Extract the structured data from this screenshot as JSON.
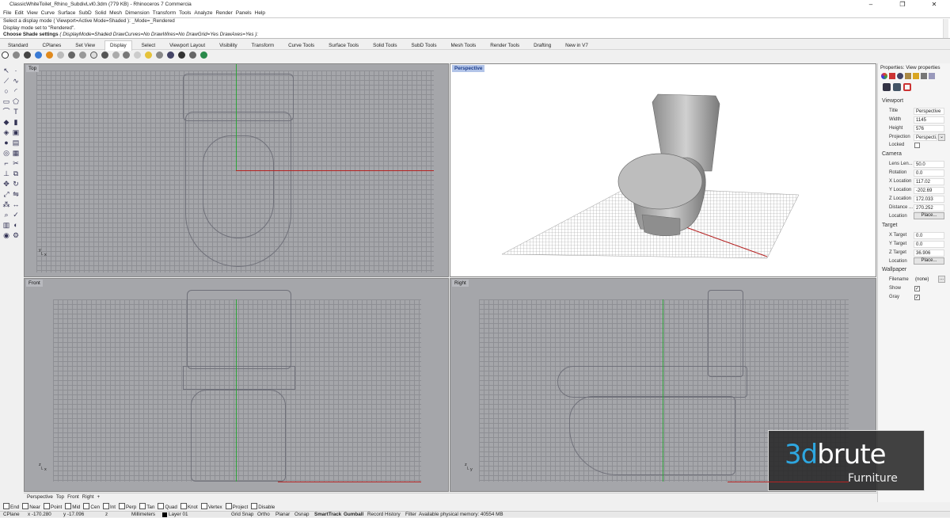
{
  "window": {
    "title": "ClassicWhiteToilet_Rhino_SubdivLvl0.3dm (779 KB) - Rhinoceros 7 Commercia",
    "min": "–",
    "max": "❐",
    "close": "✕"
  },
  "menu": [
    "File",
    "Edit",
    "View",
    "Curve",
    "Surface",
    "SubD",
    "Solid",
    "Mesh",
    "Dimension",
    "Transform",
    "Tools",
    "Analyze",
    "Render",
    "Panels",
    "Help"
  ],
  "command": {
    "line1": "Select a display mode ( Viewport=Active  Mode=Shaded ): _Mode=_Rendered",
    "line2": "Display mode set to \"Rendered\".",
    "prompt": "Choose Shade settings",
    "options": "( DisplayMode=Shaded  DrawCurves=No  DrawWires=No  DrawGrid=Yes  DrawAxes=Yes ):"
  },
  "toolbar_tabs": [
    "Standard",
    "CPlanes",
    "Set View",
    "Display",
    "Select",
    "Viewport Layout",
    "Visibility",
    "Transform",
    "Curve Tools",
    "Surface Tools",
    "Solid Tools",
    "SubD Tools",
    "Mesh Tools",
    "Render Tools",
    "Drafting",
    "New in V7"
  ],
  "active_toolbar_tab": "Display",
  "viewports": {
    "top": "Top",
    "perspective": "Perspective",
    "front": "Front",
    "right": "Right"
  },
  "viewport_tabs": [
    "Perspective",
    "Top",
    "Front",
    "Right",
    "+"
  ],
  "osnaps": [
    "End",
    "Near",
    "Point",
    "Mid",
    "Cen",
    "Int",
    "Perp",
    "Tan",
    "Quad",
    "Knot",
    "Vertex",
    "Project",
    "Disable"
  ],
  "status": {
    "cplane": "CPlane",
    "x": "x -170.280",
    "y": "y -17.096",
    "z": "z",
    "units": "Millimeters",
    "layer": "Layer 01",
    "grid_snap": "Grid Snap",
    "ortho": "Ortho",
    "planar": "Planar",
    "osnap": "Osnap",
    "smarttrack": "SmartTrack",
    "gumball": "Gumball",
    "record": "Record History",
    "filter": "Filter",
    "memory": "Available physical memory: 40554 MB"
  },
  "panel": {
    "title": "Properties: View properties",
    "viewport_section": "Viewport",
    "title_label": "Title",
    "title_value": "Perspective",
    "width_label": "Width",
    "width_value": "1145",
    "height_label": "Height",
    "height_value": "576",
    "projection_label": "Projection",
    "projection_value": "Perspecti...",
    "locked_label": "Locked",
    "camera_section": "Camera",
    "lens_label": "Lens Len...",
    "lens_value": "50.0",
    "rotation_label": "Rotation",
    "rotation_value": "0.0",
    "xloc_label": "X Location",
    "xloc_value": "117.02",
    "yloc_label": "Y Location",
    "yloc_value": "-202.69",
    "zloc_label": "Z Location",
    "zloc_value": "172.033",
    "distance_label": "Distance ...",
    "distance_value": "270.252",
    "location_label": "Location",
    "place_label": "Place...",
    "target_section": "Target",
    "xt_label": "X Target",
    "xt_value": "0.0",
    "yt_label": "Y Target",
    "yt_value": "0.0",
    "zt_label": "Z Target",
    "zt_value": "36.906",
    "tloc_label": "Location",
    "tplace_label": "Place...",
    "wallpaper_section": "Wallpaper",
    "filename_label": "Filename",
    "filename_value": "(none)",
    "show_label": "Show",
    "gray_label": "Gray",
    "check": "✓",
    "more": "...",
    "dropdown": "⌄"
  },
  "watermark": {
    "brand_a": "3d",
    "brand_b": "brute",
    "sub": "Furniture"
  },
  "colors": {
    "x_axis": "#b52222",
    "y_axis": "#2ea33a",
    "viewport_bg": "#a5a6aa",
    "active_label": "#b2c4e8"
  }
}
